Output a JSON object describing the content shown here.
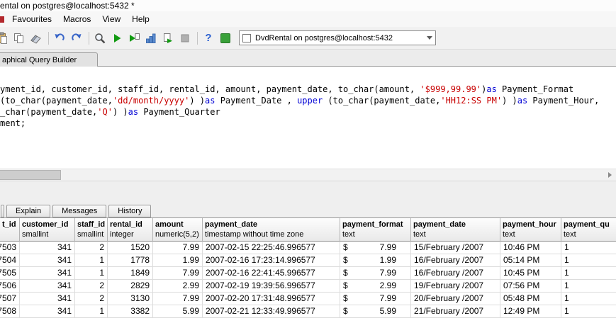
{
  "titlebar": {
    "title": "ental on postgres@localhost:5432 *"
  },
  "menubar": {
    "items": [
      "Favourites",
      "Macros",
      "View",
      "Help"
    ]
  },
  "toolbar": {
    "icon_names": [
      "paste-icon",
      "copy-icon",
      "eraser-icon",
      "undo-icon",
      "redo-icon",
      "find-icon",
      "execute-query-icon",
      "execute-pgscript-icon",
      "explain-query-icon",
      "execute-to-file-icon",
      "cancel-query-icon",
      "help-icon",
      "connection-status-icon",
      "checkbox-icon",
      "chevron-down-icon"
    ],
    "connection_combo": {
      "value": "DvdRental on postgres@localhost:5432"
    }
  },
  "editor_tabs": {
    "visible_tab": "aphical Query Builder"
  },
  "sql_editor": {
    "lines": [
      [
        {
          "c": "t",
          "t": "yment_id, customer_id, staff_id, rental_id, amount, payment_date, to_char(amount, "
        },
        {
          "c": "s",
          "t": "'$999,99.99'"
        },
        {
          "c": "t",
          "t": ")"
        },
        {
          "c": "kw",
          "t": "as"
        },
        {
          "c": "t",
          "t": " Payment_Format"
        }
      ],
      [
        {
          "c": "t",
          "t": "(to_char(payment_date,"
        },
        {
          "c": "s",
          "t": "'dd/month/yyyy'"
        },
        {
          "c": "t",
          "t": ") )"
        },
        {
          "c": "kw",
          "t": "as"
        },
        {
          "c": "t",
          "t": " Payment_Date , "
        },
        {
          "c": "kw",
          "t": "upper"
        },
        {
          "c": "t",
          "t": " (to_char(payment_date,"
        },
        {
          "c": "s",
          "t": "'HH12:SS PM'"
        },
        {
          "c": "t",
          "t": ") )"
        },
        {
          "c": "kw",
          "t": "as"
        },
        {
          "c": "t",
          "t": " Payment_Hour,"
        }
      ],
      [
        {
          "c": "t",
          "t": "_char(payment_date,"
        },
        {
          "c": "s",
          "t": "'Q'"
        },
        {
          "c": "t",
          "t": ") )"
        },
        {
          "c": "kw",
          "t": "as"
        },
        {
          "c": "t",
          "t": " Payment_Quarter"
        }
      ],
      [
        {
          "c": "t",
          "t": "ment;"
        }
      ]
    ]
  },
  "output_tabs": [
    "Explain",
    "Messages",
    "History"
  ],
  "grid": {
    "currency_symbol": "$",
    "columns": [
      {
        "name": "t_id",
        "type": ""
      },
      {
        "name": "customer_id",
        "type": "smallint"
      },
      {
        "name": "staff_id",
        "type": "smallint"
      },
      {
        "name": "rental_id",
        "type": "integer"
      },
      {
        "name": "amount",
        "type": "numeric(5,2)"
      },
      {
        "name": "payment_date",
        "type": "timestamp without time zone"
      },
      {
        "name": "payment_format",
        "type": "text"
      },
      {
        "name": "payment_date",
        "type": "text"
      },
      {
        "name": "payment_hour",
        "type": "text"
      },
      {
        "name": "payment_qu",
        "type": "text"
      }
    ],
    "rows": [
      [
        "7503",
        "341",
        "2",
        "1520",
        "7.99",
        "2007-02-15 22:25:46.996577",
        "7.99",
        "15/February /2007",
        "10:46 PM",
        "1"
      ],
      [
        "7504",
        "341",
        "1",
        "1778",
        "1.99",
        "2007-02-16 17:23:14.996577",
        "1.99",
        "16/February /2007",
        "05:14 PM",
        "1"
      ],
      [
        "7505",
        "341",
        "1",
        "1849",
        "7.99",
        "2007-02-16 22:41:45.996577",
        "7.99",
        "16/February /2007",
        "10:45 PM",
        "1"
      ],
      [
        "7506",
        "341",
        "2",
        "2829",
        "2.99",
        "2007-02-19 19:39:56.996577",
        "2.99",
        "19/February /2007",
        "07:56 PM",
        "1"
      ],
      [
        "7507",
        "341",
        "2",
        "3130",
        "7.99",
        "2007-02-20 17:31:48.996577",
        "7.99",
        "20/February /2007",
        "05:48 PM",
        "1"
      ],
      [
        "7508",
        "341",
        "1",
        "3382",
        "5.99",
        "2007-02-21 12:33:49.996577",
        "5.99",
        "21/February /2007",
        "12:49 PM",
        "1"
      ]
    ]
  },
  "colors": {
    "string_literal": "#c80000",
    "keyword": "#0000d4",
    "execute_green": "#119a11"
  }
}
